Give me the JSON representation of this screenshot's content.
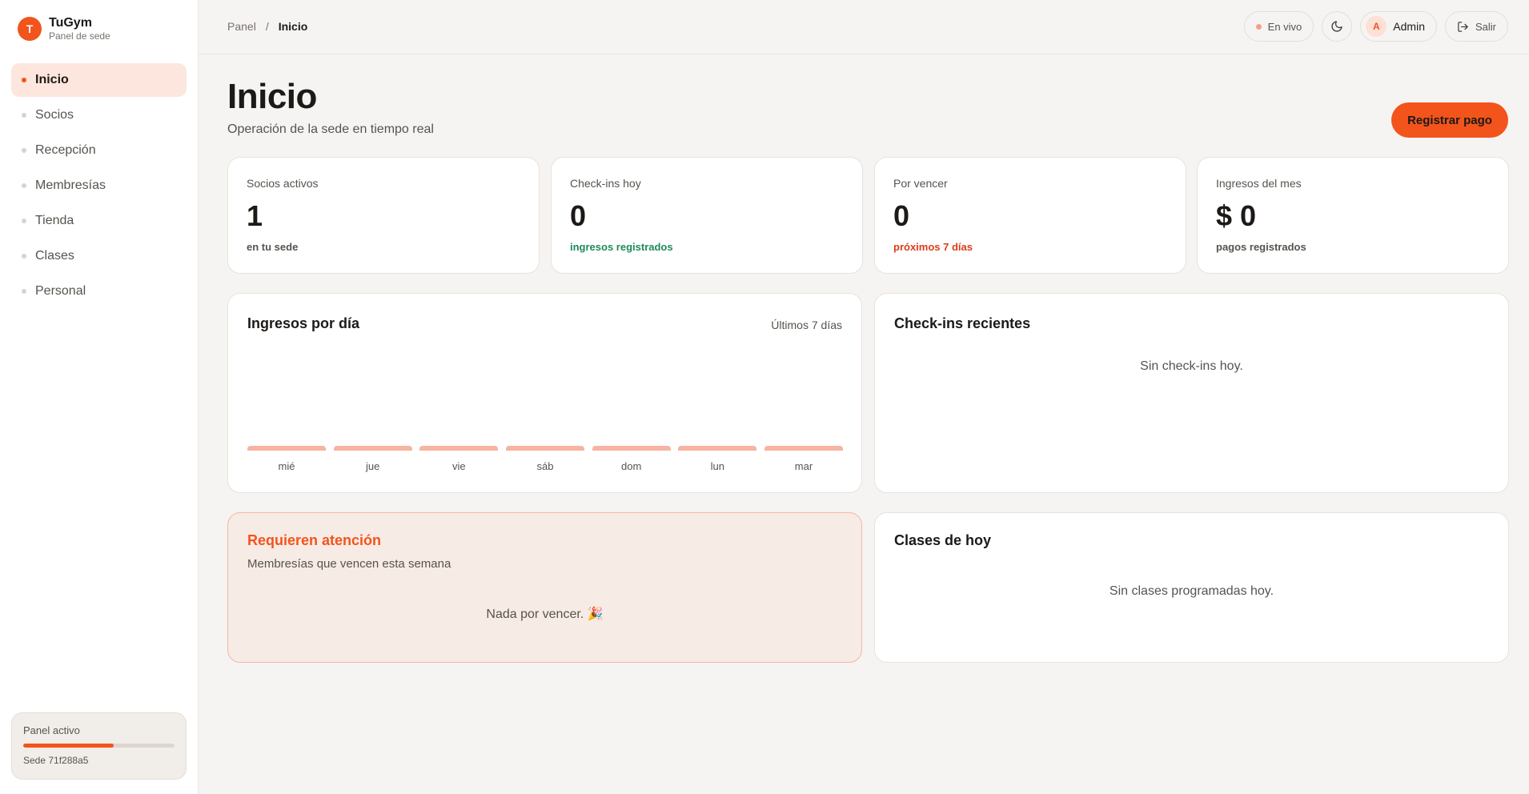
{
  "sidebar": {
    "brand_initial": "T",
    "brand_name": "TuGym",
    "brand_sub": "Panel de sede",
    "items": [
      {
        "label": "Inicio",
        "active": true
      },
      {
        "label": "Socios"
      },
      {
        "label": "Recepción"
      },
      {
        "label": "Membresías"
      },
      {
        "label": "Tienda"
      },
      {
        "label": "Clases"
      },
      {
        "label": "Personal"
      }
    ],
    "panel": {
      "label": "Panel activo",
      "progress": 0.6,
      "sede": "Sede 71f288a5"
    }
  },
  "topbar": {
    "breadcrumb": [
      "Panel",
      "/",
      "Inicio"
    ],
    "live_label": "En vivo",
    "theme_icon": "moon-icon",
    "avatar_initial": "A",
    "user_name": "Admin",
    "logout_icon": "logout-icon",
    "logout_label": "Salir"
  },
  "header": {
    "title": "Inicio",
    "subtitle": "Operación de la sede en tiempo real",
    "primary_action": "Registrar pago"
  },
  "stats": [
    {
      "label": "Socios activos",
      "value": "1",
      "foot": "en tu sede",
      "tone": "neutral"
    },
    {
      "label": "Check-ins hoy",
      "value": "0",
      "foot": "ingresos registrados",
      "tone": "green"
    },
    {
      "label": "Por vencer",
      "value": "0",
      "foot": "próximos 7 días",
      "tone": "red"
    },
    {
      "label": "Ingresos del mes",
      "value": "$ 0",
      "foot": "pagos registrados",
      "tone": "neutral"
    }
  ],
  "revenue": {
    "title": "Ingresos por día",
    "range": "Últimos 7 días",
    "days": [
      "mié",
      "jue",
      "vie",
      "sáb",
      "dom",
      "lun",
      "mar"
    ]
  },
  "checkins": {
    "title": "Check-ins recientes",
    "empty": "Sin check-ins hoy."
  },
  "attention": {
    "title": "Requieren atención",
    "subtitle": "Membresías que vencen esta semana",
    "empty": "Nada por vencer. 🎉"
  },
  "classes": {
    "title": "Clases de hoy",
    "empty": "Sin clases programadas hoy."
  },
  "colors": {
    "accent": "#f2541b",
    "bar": "#f6b4a2",
    "green": "#1f8a5b",
    "red": "#dc3c1a"
  }
}
